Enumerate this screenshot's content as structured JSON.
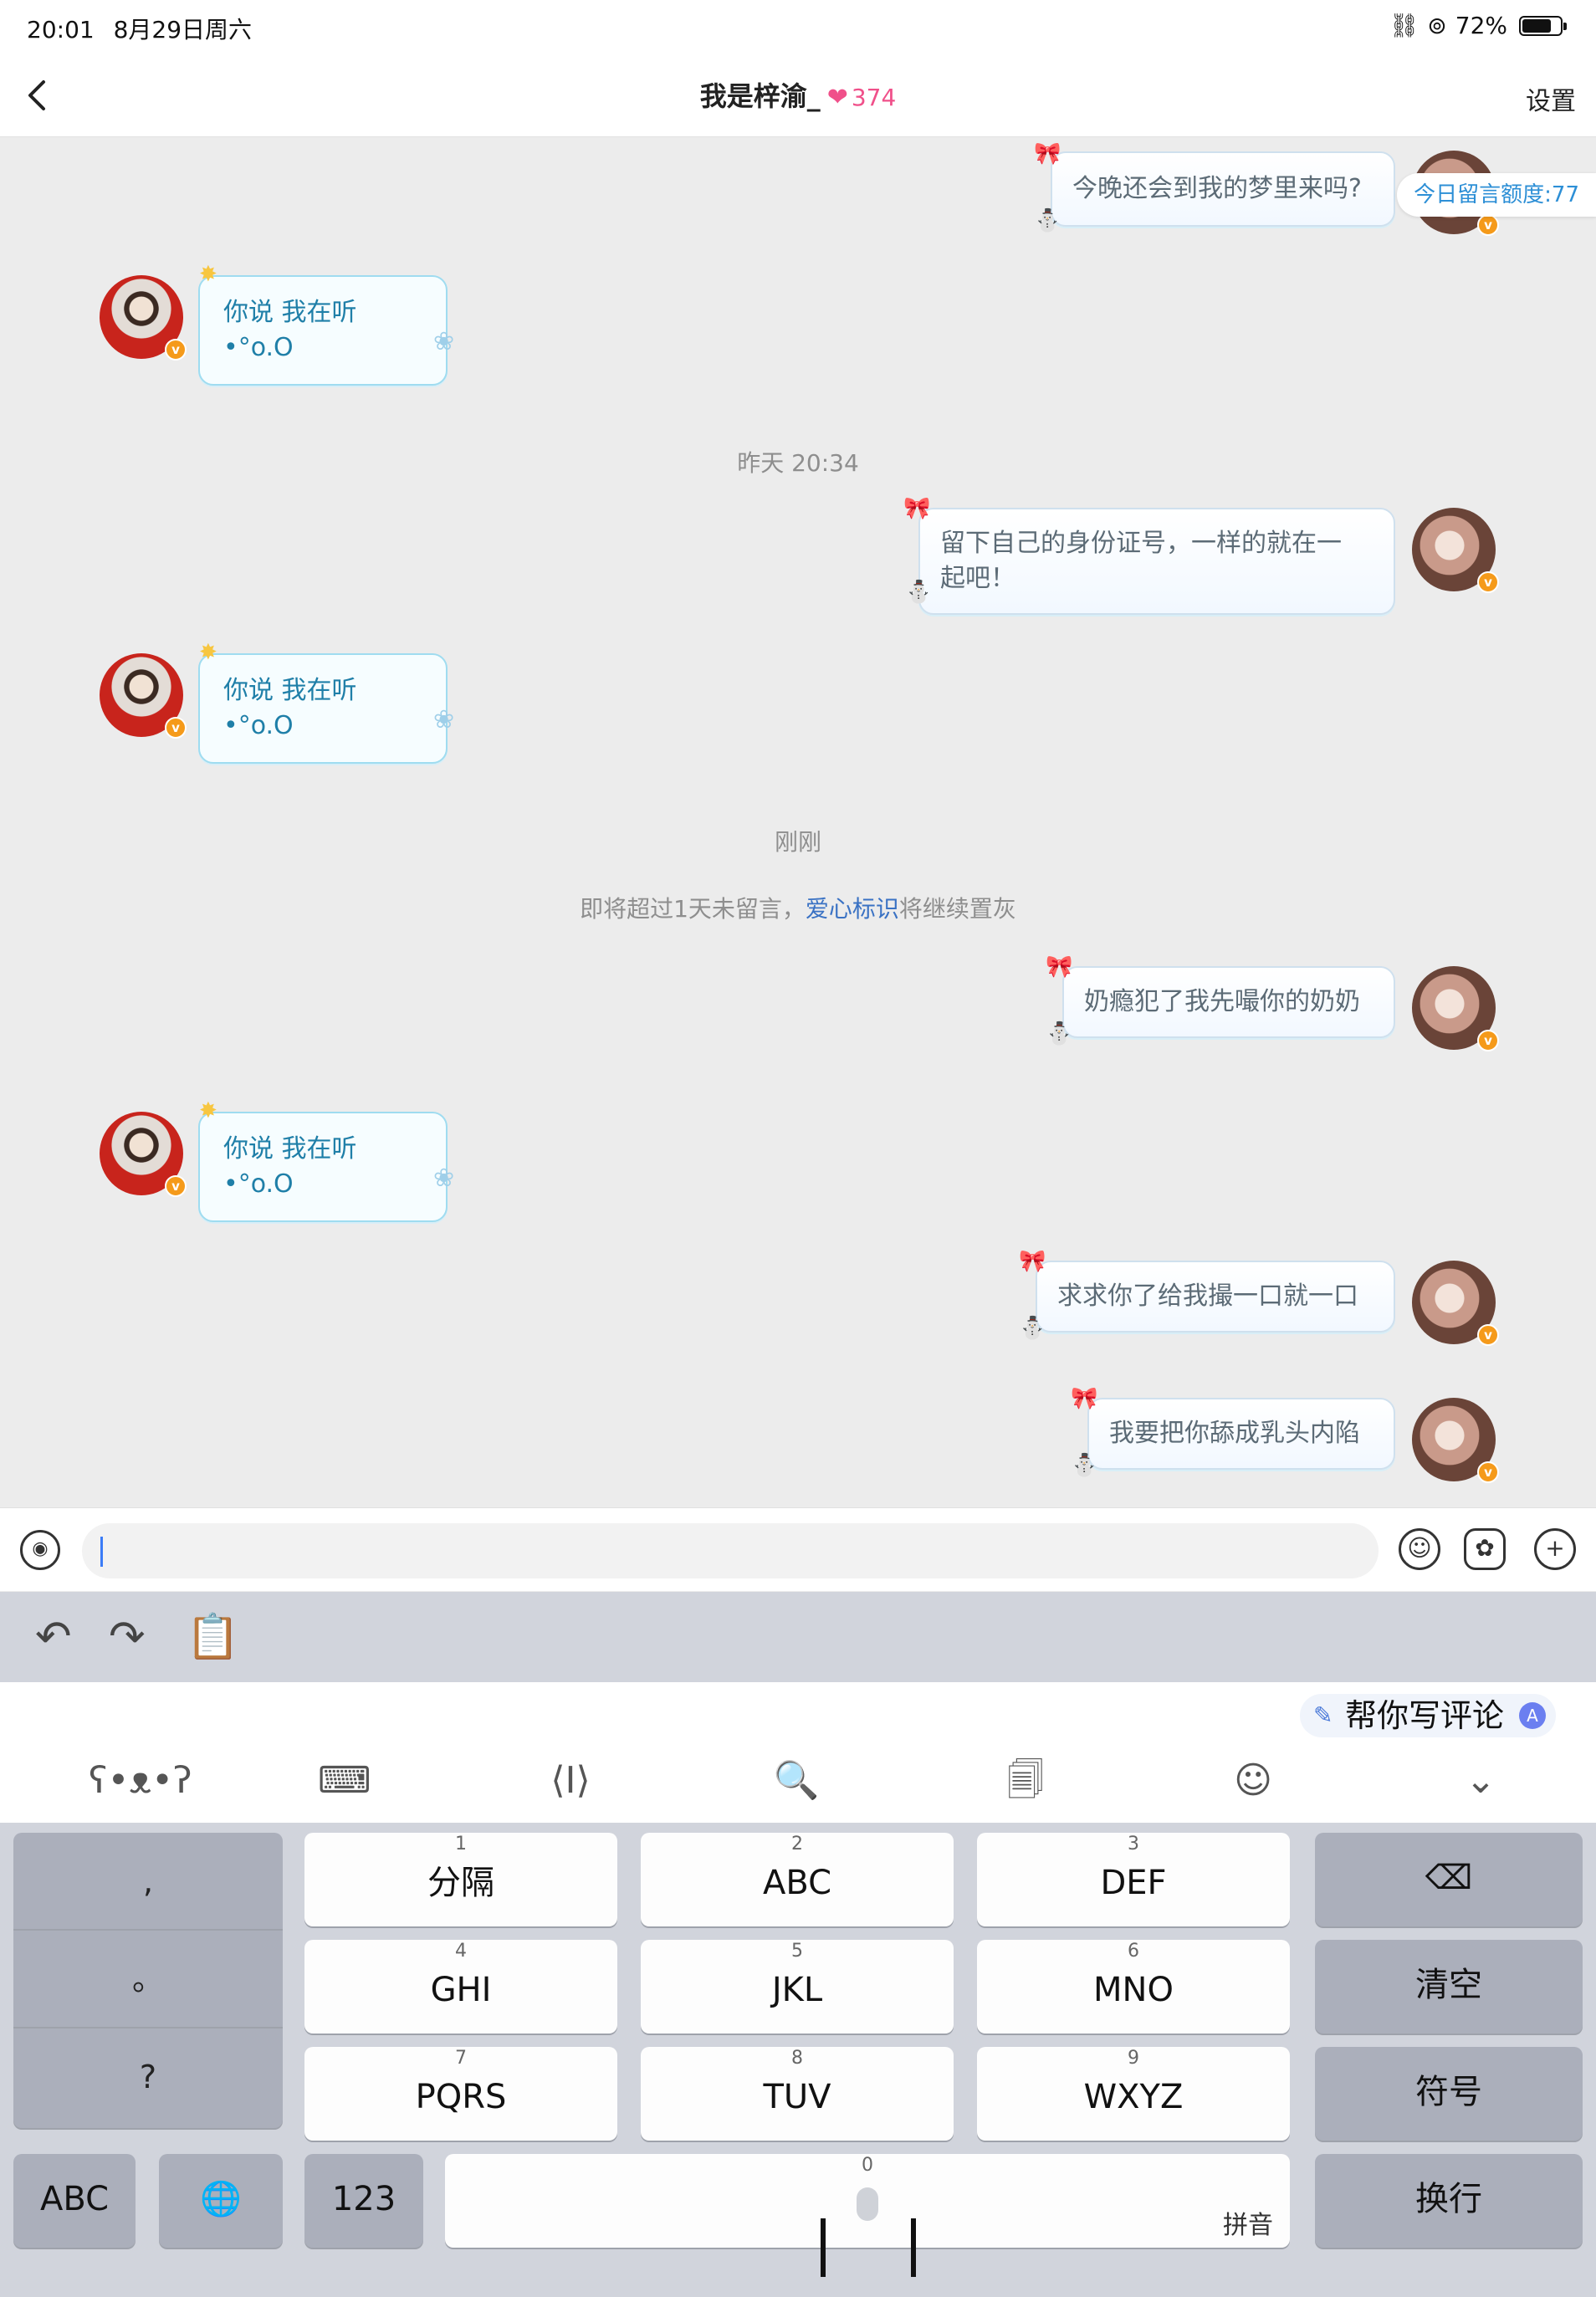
{
  "status_bar": {
    "time": "20:01",
    "date": "8月29日周六",
    "battery_text": "72%",
    "battery_level": 0.72
  },
  "header": {
    "title": "我是梓渝_",
    "heart_glyph": "❤",
    "score": "374",
    "settings": "设置"
  },
  "quota": "今日留言额度:77",
  "messages": [
    {
      "side": "right",
      "text": "今晚还会到我的梦里来吗?"
    },
    {
      "side": "left",
      "text": "你说 我在听•°o.O"
    },
    {
      "side": "right",
      "text_line1": "留下自己的身份证号，一样的就在一",
      "text_line2": "起吧！"
    },
    {
      "side": "left",
      "text": "你说 我在听•°o.O"
    },
    {
      "side": "right",
      "text": "奶瘾犯了我先嘬你的奶奶"
    },
    {
      "side": "left",
      "text": "你说 我在听•°o.O"
    },
    {
      "side": "right",
      "text": "求求你了给我撮一口就一口"
    },
    {
      "side": "right",
      "text": "我要把你舔成乳头内陷"
    }
  ],
  "timestamps": {
    "yesterday": "昨天 20:34",
    "just_now": "刚刚"
  },
  "notice": {
    "before": "即将超过1天未留言，",
    "link": "爱心标识",
    "after": "将继续置灰"
  },
  "input": {
    "placeholder": ""
  },
  "icons": {
    "voice": "voice-icon",
    "emoji": "emoji-icon",
    "sticker": "sticker-icon",
    "add": "add-icon",
    "undo": "undo-icon",
    "redo": "redo-icon",
    "clipboard": "clipboard-icon"
  },
  "suggest": {
    "ai_label": "帮你写评论"
  },
  "keyboard": {
    "punct": [
      ",",
      "。",
      "?"
    ],
    "keys": [
      {
        "num": "1",
        "label": "分隔"
      },
      {
        "num": "2",
        "label": "ABC"
      },
      {
        "num": "3",
        "label": "DEF"
      },
      {
        "num": "4",
        "label": "GHI"
      },
      {
        "num": "5",
        "label": "JKL"
      },
      {
        "num": "6",
        "label": "MNO"
      },
      {
        "num": "7",
        "label": "PQRS"
      },
      {
        "num": "8",
        "label": "TUV"
      },
      {
        "num": "9",
        "label": "WXYZ"
      }
    ],
    "delete": "⌫",
    "clear": "清空",
    "symbols": "符号",
    "abc": "ABC",
    "globe": "🌐",
    "num123": "123",
    "space_num": "0",
    "space_hint": "拼音",
    "enter": "换行"
  }
}
